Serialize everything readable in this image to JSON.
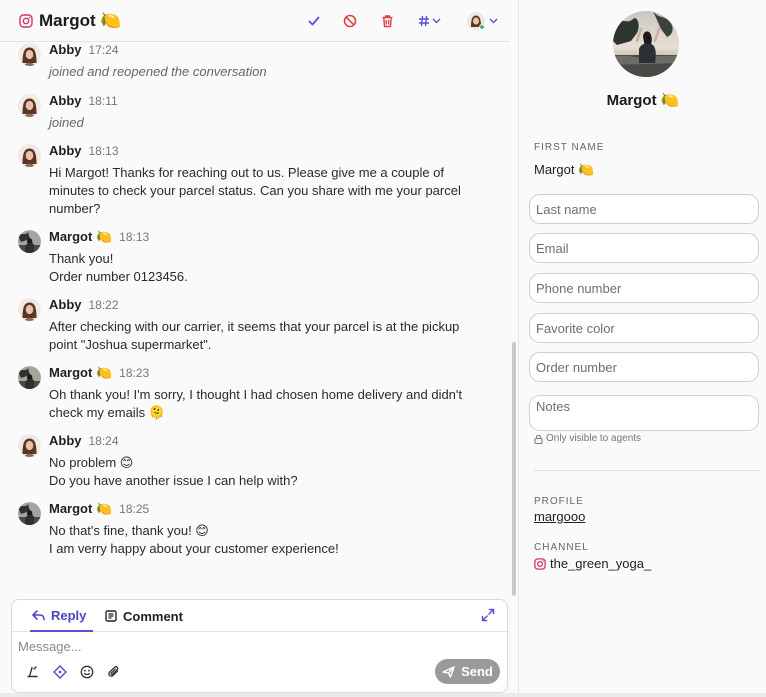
{
  "header": {
    "title": "Margot 🍋",
    "tools": [
      "check-icon",
      "ban-icon",
      "trash-icon",
      "hashtag-icon",
      "assignee-avatar"
    ]
  },
  "messages": [
    {
      "author": "Abby",
      "time": "17:24",
      "system": true,
      "avatar": "abby",
      "lines": [
        "joined and reopened the conversation"
      ]
    },
    {
      "author": "Abby",
      "time": "18:11",
      "system": true,
      "avatar": "abby",
      "lines": [
        "joined"
      ]
    },
    {
      "author": "Abby",
      "time": "18:13",
      "system": false,
      "avatar": "abby",
      "lines": [
        "Hi Margot! Thanks for reaching out to us. Please give me a couple of",
        "minutes to check your parcel status. Can you share with me your parcel",
        "number?"
      ]
    },
    {
      "author": "Margot 🍋",
      "time": "18:13",
      "system": false,
      "avatar": "margot",
      "lines": [
        "Thank you!",
        "Order number 0123456."
      ]
    },
    {
      "author": "Abby",
      "time": "18:22",
      "system": false,
      "avatar": "abby",
      "lines": [
        "After checking with our carrier, it seems that your parcel is at the pickup",
        "point \"Joshua supermarket\"."
      ]
    },
    {
      "author": "Margot 🍋",
      "time": "18:23",
      "system": false,
      "avatar": "margot",
      "lines": [
        "Oh thank you! I'm sorry, I thought I had chosen home delivery and didn't",
        "check my emails 🫠"
      ]
    },
    {
      "author": "Abby",
      "time": "18:24",
      "system": false,
      "avatar": "abby",
      "lines": [
        "No problem 😊",
        "Do you have another issue I can help with?"
      ]
    },
    {
      "author": "Margot 🍋",
      "time": "18:25",
      "system": false,
      "avatar": "margot",
      "lines": [
        "No that's fine, thank you! 😊",
        "I am verry happy about your customer experience!"
      ]
    }
  ],
  "composer": {
    "tab_reply": "Reply",
    "tab_comment": "Comment",
    "placeholder": "Message...",
    "send_label": "Send"
  },
  "contact": {
    "name": "Margot 🍋",
    "first_name_label": "FIRST NAME",
    "first_name_value": "Margot 🍋",
    "fields": [
      {
        "placeholder": "Last name"
      },
      {
        "placeholder": "Email"
      },
      {
        "placeholder": "Phone number"
      },
      {
        "placeholder": "Favorite color"
      },
      {
        "placeholder": "Order number"
      }
    ],
    "notes_placeholder": "Notes",
    "notes_hint": "Only visible to agents",
    "profile_label": "PROFILE",
    "profile_value": "margooo",
    "channel_label": "CHANNEL",
    "channel_value": "the_green_yoga_"
  },
  "colors": {
    "accent": "#5a52d5",
    "danger": "#e0433f",
    "instagram": "#d6336c",
    "send_disabled": "#9a9a9a"
  }
}
